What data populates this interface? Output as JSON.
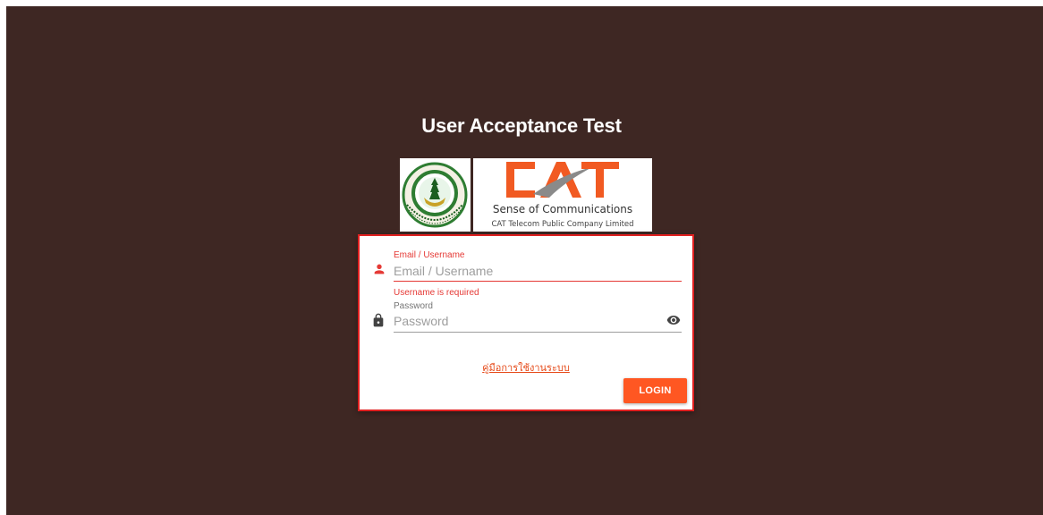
{
  "page": {
    "title": "User Acceptance Test"
  },
  "logos": {
    "ministry": {
      "icon": "ministry-digital-economy-seal-icon"
    },
    "cat": {
      "wordmark": "CAT",
      "tagline": "Sense of Communications",
      "company": "CAT Telecom Public Company Limited"
    }
  },
  "form": {
    "username": {
      "label": "Email / Username",
      "placeholder": "Email / Username",
      "value": "",
      "error": "Username is required",
      "icon": "person-icon"
    },
    "password": {
      "label": "Password",
      "placeholder": "Password",
      "value": "",
      "icon": "lock-icon",
      "toggle_icon": "eye-icon"
    },
    "manual_link": "คู่มือการใช้งานระบบ",
    "login_label": "LOGIN"
  },
  "colors": {
    "background": "#3e2723",
    "error": "#e53935",
    "accent": "#ff5722",
    "card_border": "#e02020",
    "cat_orange": "#f15a22"
  }
}
